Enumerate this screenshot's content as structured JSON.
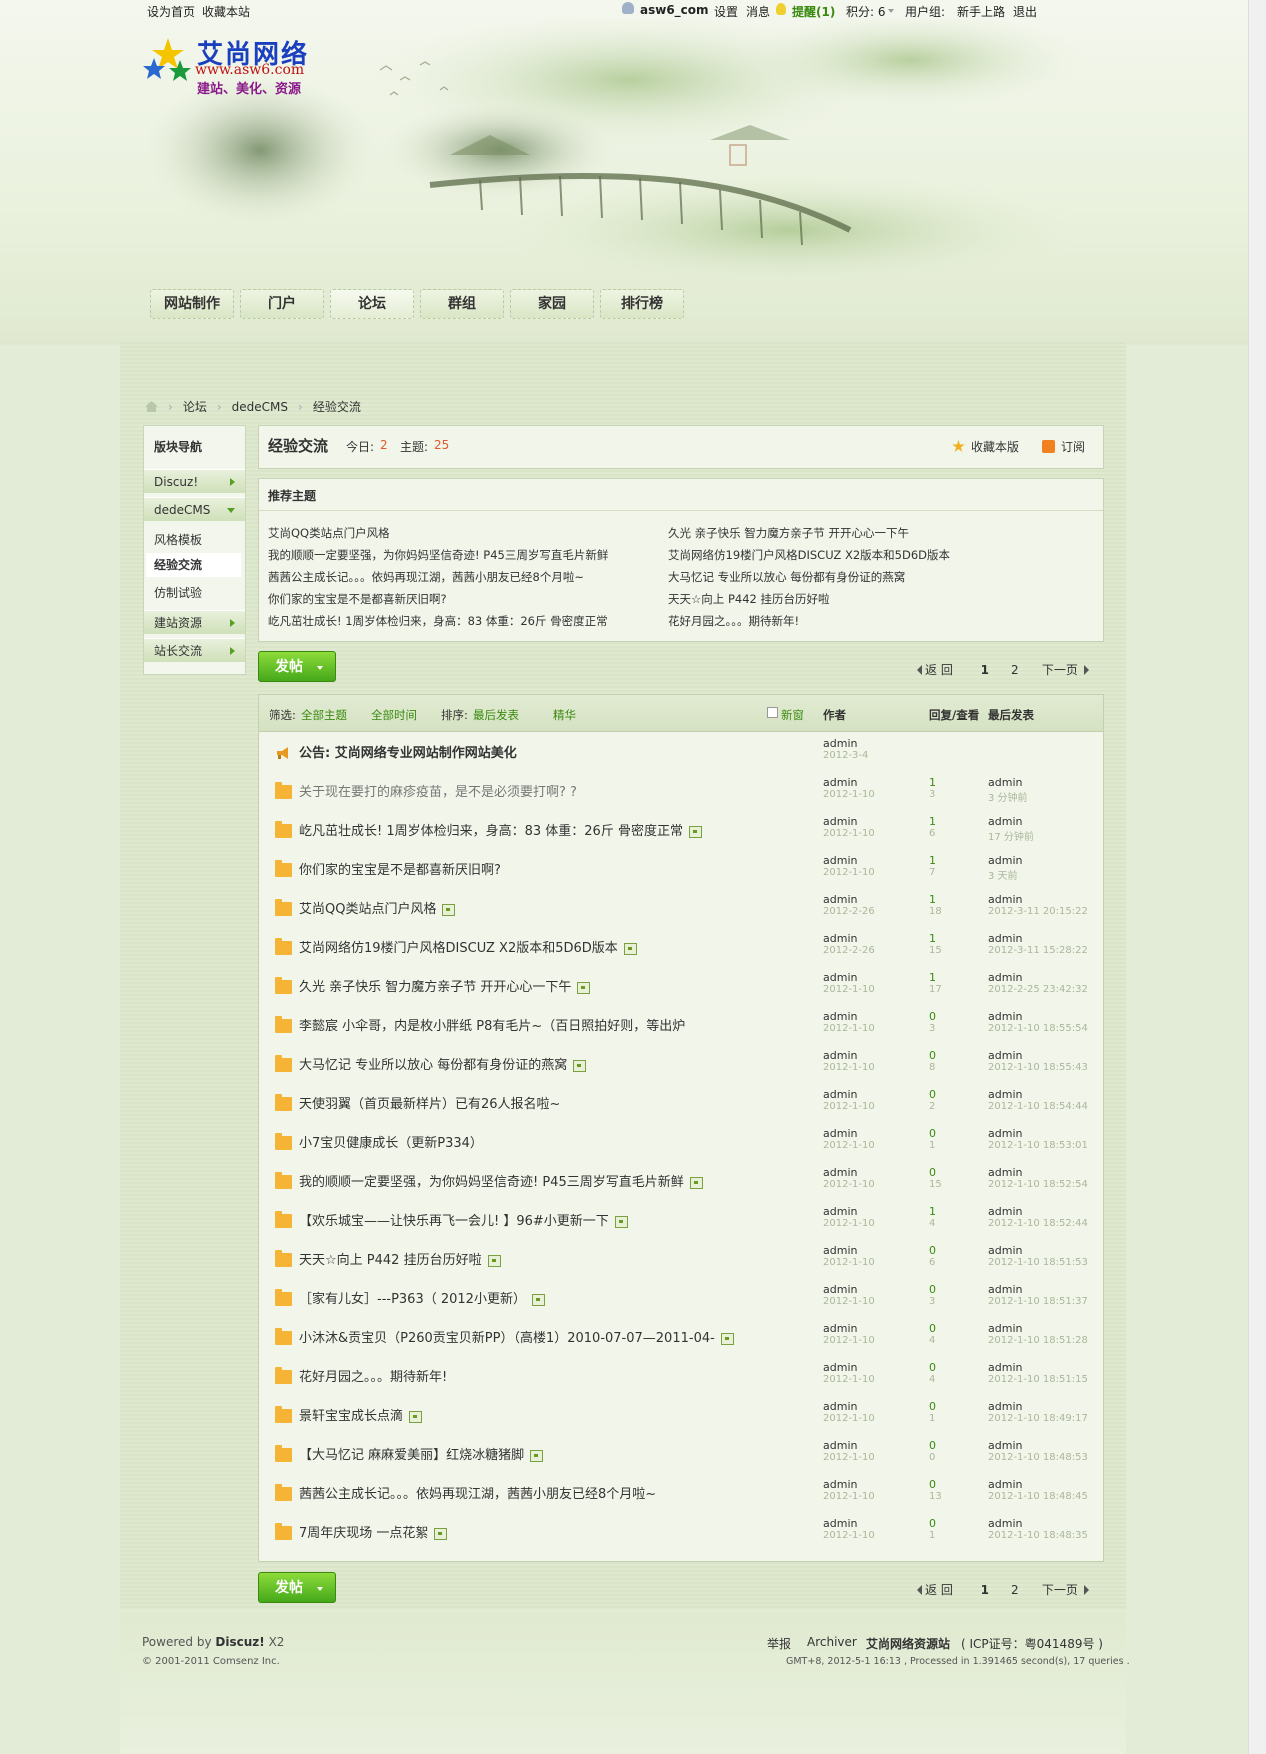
{
  "topbar": {
    "left_links": [
      "设为首页",
      "收藏本站"
    ],
    "username": "asw6_com",
    "settings": "设置",
    "messages": "消息",
    "remind": "提醒(1)",
    "credits_label": "积分: 6",
    "usergroup_label": "用户组:",
    "usergroup_value": "新手上路",
    "logout": "退出"
  },
  "logo": {
    "name": "艾尚网络",
    "url": "www.asw6.com",
    "slogan": "建站、美化、资源"
  },
  "nav": [
    "网站制作",
    "门户",
    "论坛",
    "群组",
    "家园",
    "排行榜"
  ],
  "breadcrumb": [
    "论坛",
    "dedeCMS",
    "经验交流"
  ],
  "side": {
    "title": "版块导航",
    "groups": [
      {
        "label": "Discuz!"
      },
      {
        "label": "dedeCMS",
        "subs": [
          "风格模板",
          "经验交流",
          "仿制试验"
        ]
      },
      {
        "label": "建站资源"
      },
      {
        "label": "站长交流"
      }
    ]
  },
  "forum": {
    "name": "经验交流",
    "today_label": "今日:",
    "today_value": "2",
    "topics_label": "主题:",
    "topics_value": "25",
    "favorite": "收藏本版",
    "subscribe": "订阅"
  },
  "recommended": {
    "title": "推荐主题",
    "left": [
      "艾尚QQ类站点门户风格",
      "我的顺顺一定要坚强，为你妈妈坚信奇迹! P45三周岁写直毛片新鲜",
      "茜茜公主成长记。。。依妈再现江湖，茜茜小朋友已经8个月啦~",
      "你们家的宝宝是不是都喜新厌旧啊?",
      "屹凡茁壮成长! 1周岁体检归来，身高：83 体重：26斤 骨密度正常"
    ],
    "right": [
      "久光 亲子快乐 智力魔方亲子节 开开心心一下午",
      "艾尚网络仿19楼门户风格DISCUZ X2版本和5D6D版本",
      "大马忆记 专业所以放心 每份都有身份证的燕窝",
      "天天☆向上 P442 挂历台历好啦",
      "花好月园之。。。期待新年!"
    ]
  },
  "post_button": "发帖",
  "pager": {
    "back": "返 回",
    "pages": [
      "1",
      "2"
    ],
    "next": "下一页"
  },
  "table_header": {
    "filter_label": "筛选:",
    "all_topics": "全部主题",
    "all_time": "全部时间",
    "sort_label": "排序:",
    "sort_value": "最后发表",
    "digest": "精华",
    "new_window": "新窗",
    "author": "作者",
    "replies_views": "回复/查看",
    "last_post": "最后发表"
  },
  "announcement": {
    "subject": "公告: 艾尚网络专业网站制作网站美化",
    "author": "admin",
    "date": "2012-3-4"
  },
  "threads": [
    {
      "subject": "关于现在要打的麻疹疫苗，是不是必须要打啊? ?",
      "img": false,
      "author": "admin",
      "date": "2012-1-10",
      "replies": "1",
      "views": "3",
      "last_user": "admin",
      "last_time": "3 分钟前",
      "gray": true
    },
    {
      "subject": "屹凡茁壮成长! 1周岁体检归来，身高：83 体重：26斤 骨密度正常",
      "img": true,
      "author": "admin",
      "date": "2012-1-10",
      "replies": "1",
      "views": "6",
      "last_user": "admin",
      "last_time": "17 分钟前"
    },
    {
      "subject": "你们家的宝宝是不是都喜新厌旧啊?",
      "img": false,
      "author": "admin",
      "date": "2012-1-10",
      "replies": "1",
      "views": "7",
      "last_user": "admin",
      "last_time": "3 天前"
    },
    {
      "subject": "艾尚QQ类站点门户风格",
      "img": true,
      "author": "admin",
      "date": "2012-2-26",
      "replies": "1",
      "views": "18",
      "last_user": "admin",
      "last_time": "2012-3-11 20:15:22"
    },
    {
      "subject": "艾尚网络仿19楼门户风格DISCUZ X2版本和5D6D版本",
      "img": true,
      "author": "admin",
      "date": "2012-2-26",
      "replies": "1",
      "views": "15",
      "last_user": "admin",
      "last_time": "2012-3-11 15:28:22"
    },
    {
      "subject": "久光 亲子快乐 智力魔方亲子节 开开心心一下午",
      "img": true,
      "author": "admin",
      "date": "2012-1-10",
      "replies": "1",
      "views": "17",
      "last_user": "admin",
      "last_time": "2012-2-25 23:42:32"
    },
    {
      "subject": "李懿宸 小伞哥，内是枚小胖纸 P8有毛片~（百日照拍好则，等出炉",
      "img": false,
      "author": "admin",
      "date": "2012-1-10",
      "replies": "0",
      "views": "3",
      "last_user": "admin",
      "last_time": "2012-1-10 18:55:54"
    },
    {
      "subject": "大马忆记 专业所以放心 每份都有身份证的燕窝",
      "img": true,
      "author": "admin",
      "date": "2012-1-10",
      "replies": "0",
      "views": "8",
      "last_user": "admin",
      "last_time": "2012-1-10 18:55:43"
    },
    {
      "subject": "天使羽翼（首页最新样片）已有26人报名啦~",
      "img": false,
      "author": "admin",
      "date": "2012-1-10",
      "replies": "0",
      "views": "2",
      "last_user": "admin",
      "last_time": "2012-1-10 18:54:44"
    },
    {
      "subject": "小7宝贝健康成长（更新P334）",
      "img": false,
      "author": "admin",
      "date": "2012-1-10",
      "replies": "0",
      "views": "1",
      "last_user": "admin",
      "last_time": "2012-1-10 18:53:01"
    },
    {
      "subject": "我的顺顺一定要坚强，为你妈妈坚信奇迹! P45三周岁写直毛片新鲜",
      "img": true,
      "author": "admin",
      "date": "2012-1-10",
      "replies": "0",
      "views": "15",
      "last_user": "admin",
      "last_time": "2012-1-10 18:52:54"
    },
    {
      "subject": "【欢乐城宝——让快乐再飞一会儿! 】96#小更新一下",
      "img": true,
      "author": "admin",
      "date": "2012-1-10",
      "replies": "1",
      "views": "4",
      "last_user": "admin",
      "last_time": "2012-1-10 18:52:44"
    },
    {
      "subject": "天天☆向上 P442 挂历台历好啦",
      "img": true,
      "author": "admin",
      "date": "2012-1-10",
      "replies": "0",
      "views": "6",
      "last_user": "admin",
      "last_time": "2012-1-10 18:51:53"
    },
    {
      "subject": "［家有儿女］---P363（ 2012小更新）",
      "img": true,
      "author": "admin",
      "date": "2012-1-10",
      "replies": "0",
      "views": "3",
      "last_user": "admin",
      "last_time": "2012-1-10 18:51:37"
    },
    {
      "subject": "小沐沐&贡宝贝（P260贡宝贝新PP）（高楼1）2010-07-07—2011-04-",
      "img": true,
      "author": "admin",
      "date": "2012-1-10",
      "replies": "0",
      "views": "4",
      "last_user": "admin",
      "last_time": "2012-1-10 18:51:28"
    },
    {
      "subject": "花好月园之。。。期待新年!",
      "img": false,
      "author": "admin",
      "date": "2012-1-10",
      "replies": "0",
      "views": "4",
      "last_user": "admin",
      "last_time": "2012-1-10 18:51:15"
    },
    {
      "subject": "景轩宝宝成长点滴",
      "img": true,
      "author": "admin",
      "date": "2012-1-10",
      "replies": "0",
      "views": "1",
      "last_user": "admin",
      "last_time": "2012-1-10 18:49:17"
    },
    {
      "subject": "【大马忆记 麻麻爱美丽】红烧冰糖猪脚",
      "img": true,
      "author": "admin",
      "date": "2012-1-10",
      "replies": "0",
      "views": "0",
      "last_user": "admin",
      "last_time": "2012-1-10 18:48:53"
    },
    {
      "subject": "茜茜公主成长记。。。依妈再现江湖，茜茜小朋友已经8个月啦~",
      "img": false,
      "author": "admin",
      "date": "2012-1-10",
      "replies": "0",
      "views": "13",
      "last_user": "admin",
      "last_time": "2012-1-10 18:48:45"
    },
    {
      "subject": "7周年庆现场 一点花絮",
      "img": true,
      "author": "admin",
      "date": "2012-1-10",
      "replies": "0",
      "views": "1",
      "last_user": "admin",
      "last_time": "2012-1-10 18:48:35"
    }
  ],
  "footer": {
    "powered_prefix": "Powered by",
    "powered_name": "Discuz!",
    "powered_ver": "X2",
    "copyright": "© 2001-2011 Comsenz Inc.",
    "report": "举报",
    "archiver": "Archiver",
    "site": "艾尚网络资源站",
    "icp": "( ICP证号：粤041489号 )",
    "stats": "GMT+8, 2012-5-1 16:13 , Processed in 1.391465 second(s), 17 queries ."
  }
}
